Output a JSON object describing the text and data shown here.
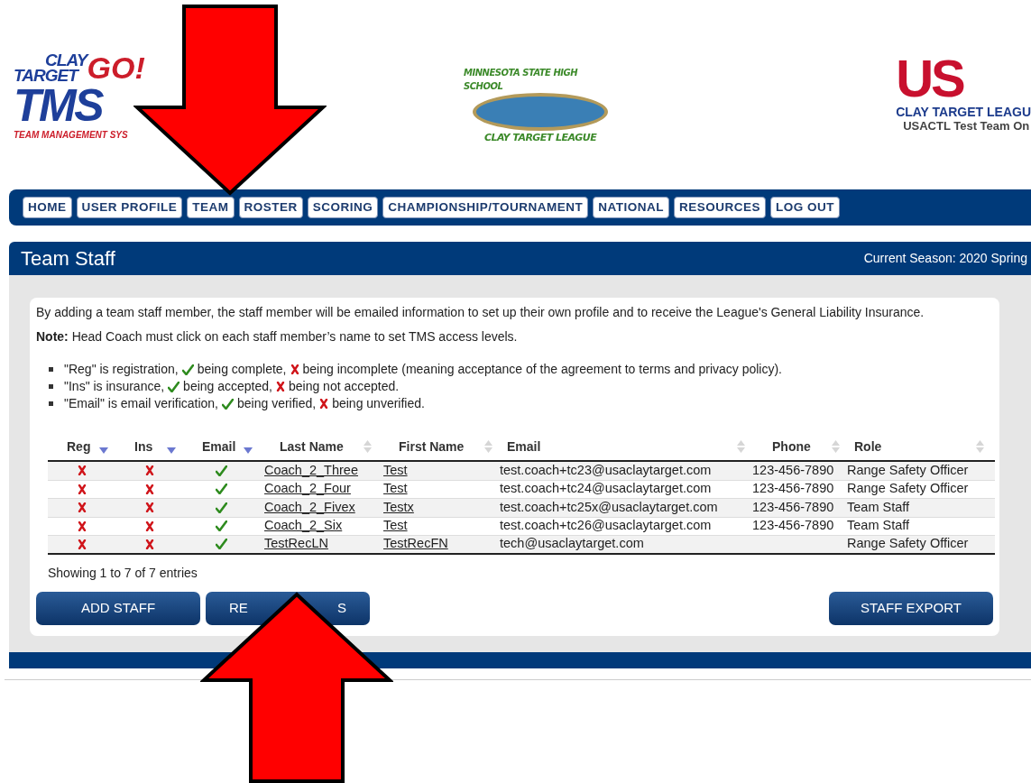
{
  "header": {
    "tms_logo": {
      "line1": "CLAY",
      "line2": "TARGET",
      "go": "GO!",
      "big": "TMS",
      "tagline": "TEAM MANAGEMENT SYS"
    },
    "state_logo": {
      "top": "MINNESOTA STATE HIGH SCHOOL",
      "bottom": "CLAY TARGET LEAGUE"
    },
    "usa_logo": {
      "mark": "US",
      "league": "CLAY TARGET LEAGU",
      "team": "USACTL Test Team On"
    }
  },
  "nav": [
    {
      "label": "HOME"
    },
    {
      "label": "USER PROFILE"
    },
    {
      "label": "TEAM"
    },
    {
      "label": "ROSTER"
    },
    {
      "label": "SCORING"
    },
    {
      "label": "CHAMPIONSHIP/TOURNAMENT"
    },
    {
      "label": "NATIONAL"
    },
    {
      "label": "RESOURCES"
    },
    {
      "label": "LOG OUT"
    }
  ],
  "page": {
    "title": "Team Staff",
    "season": "Current Season: 2020 Spring"
  },
  "intro": "By adding a team staff member, the staff member will be emailed information to set up their own profile and to receive the League's General Liability Insurance.",
  "note": "**Note:** Head Coach must click on each staff member’s name to set TMS access levels.",
  "legend": [
    {
      "lead": "\"Reg\" is registration,",
      "check_meaning": "being complete,",
      "cross_meaning": "being incomplete (meaning acceptance of the agreement to terms and privacy policy)."
    },
    {
      "lead": "\"Ins\" is insurance,",
      "check_meaning": "being accepted,",
      "cross_meaning": "being not accepted."
    },
    {
      "lead": "\"Email\" is email verification,",
      "check_meaning": "being verified,",
      "cross_meaning": "being unverified."
    }
  ],
  "table": {
    "columns": [
      {
        "label": "Reg",
        "sorted": true
      },
      {
        "label": "Ins",
        "sorted": true
      },
      {
        "label": "Email",
        "sorted": true
      },
      {
        "label": "Last Name",
        "sorted": false
      },
      {
        "label": "First Name",
        "sorted": false
      },
      {
        "label": "Email",
        "sorted": false
      },
      {
        "label": "Phone",
        "sorted": false
      },
      {
        "label": "Role",
        "sorted": false
      }
    ],
    "rows": [
      {
        "reg": false,
        "ins": false,
        "email_verified": true,
        "last_name": "Coach_2_Three",
        "first_name": "Test",
        "email": "test.coach+tc23@usaclaytarget.com",
        "phone": "123-456-7890",
        "role": "Range Safety Officer"
      },
      {
        "reg": false,
        "ins": false,
        "email_verified": true,
        "last_name": "Coach_2_Four",
        "first_name": "Test",
        "email": "test.coach+tc24@usaclaytarget.com",
        "phone": "123-456-7890",
        "role": "Range Safety Officer"
      },
      {
        "reg": false,
        "ins": false,
        "email_verified": true,
        "last_name": "Coach_2_Fivex",
        "first_name": "Testx",
        "email": "test.coach+tc25x@usaclaytarget.com",
        "phone": "123-456-7890",
        "role": "Team Staff"
      },
      {
        "reg": false,
        "ins": false,
        "email_verified": true,
        "last_name": "Coach_2_Six",
        "first_name": "Test",
        "email": "test.coach+tc26@usaclaytarget.com",
        "phone": "123-456-7890",
        "role": "Team Staff"
      },
      {
        "reg": false,
        "ins": false,
        "email_verified": true,
        "last_name": "TestRecLN",
        "first_name": "TestRecFN",
        "email": "tech@usaclaytarget.com",
        "role": "Range Safety Officer"
      }
    ]
  },
  "entries_info": "Showing 1 to 7 of 7 entries",
  "buttons": {
    "add": "ADD STAFF",
    "middle_visible": [
      "RE",
      "S"
    ],
    "export": "STAFF EXPORT"
  }
}
